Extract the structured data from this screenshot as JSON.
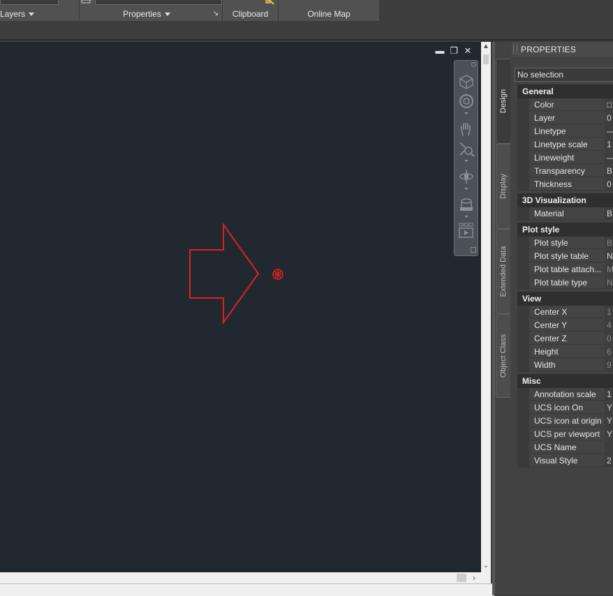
{
  "ribbon": {
    "panels": [
      {
        "label": "Layers",
        "dropdown": true
      },
      {
        "label": "Properties",
        "dropdown": true
      },
      {
        "label": "Clipboard",
        "dropdown": false
      },
      {
        "label": "Online Map",
        "dropdown": false
      }
    ],
    "launcher_glyph": "↘"
  },
  "viewport": {
    "background": "#212830",
    "drawing_color": "#e02020",
    "controls": {
      "minimize": "▬",
      "restore": "❐",
      "close": "✕"
    }
  },
  "navbar": {
    "icons": [
      "viewcube-icon",
      "steering-wheel-icon",
      "pan-icon",
      "zoom-icon",
      "orbit-icon",
      "showmotion-icon",
      "play-icon"
    ]
  },
  "scrollbars": {
    "up": "▲",
    "down": "⌄",
    "right": "›"
  },
  "palette": {
    "title": "PROPERTIES",
    "tabs": [
      "Design",
      "Display",
      "Extended Data",
      "Object Class"
    ],
    "selection": "No selection",
    "categories": [
      {
        "name": "General",
        "rows": [
          {
            "label": "Color",
            "value": "□"
          },
          {
            "label": "Layer",
            "value": "0"
          },
          {
            "label": "Linetype",
            "value": "—"
          },
          {
            "label": "Linetype scale",
            "value": "1"
          },
          {
            "label": "Lineweight",
            "value": "—"
          },
          {
            "label": "Transparency",
            "value": "B"
          },
          {
            "label": "Thickness",
            "value": "0"
          }
        ]
      },
      {
        "name": "3D Visualization",
        "rows": [
          {
            "label": "Material",
            "value": "B"
          }
        ]
      },
      {
        "name": "Plot style",
        "rows": [
          {
            "label": "Plot style",
            "value": "B",
            "dim": true
          },
          {
            "label": "Plot style table",
            "value": "N"
          },
          {
            "label": "Plot table attach...",
            "value": "M",
            "dim": true
          },
          {
            "label": "Plot table type",
            "value": "N",
            "dim": true
          }
        ]
      },
      {
        "name": "View",
        "rows": [
          {
            "label": "Center X",
            "value": "1",
            "dim": true
          },
          {
            "label": "Center Y",
            "value": "4",
            "dim": true
          },
          {
            "label": "Center Z",
            "value": "0",
            "dim": true
          },
          {
            "label": "Height",
            "value": "6",
            "dim": true
          },
          {
            "label": "Width",
            "value": "9",
            "dim": true
          }
        ]
      },
      {
        "name": "Misc",
        "rows": [
          {
            "label": "Annotation scale",
            "value": "1"
          },
          {
            "label": "UCS icon On",
            "value": "Y"
          },
          {
            "label": "UCS icon at origin",
            "value": "Y"
          },
          {
            "label": "UCS per viewport",
            "value": "Y"
          },
          {
            "label": "UCS Name",
            "value": ""
          },
          {
            "label": "Visual Style",
            "value": "2"
          }
        ]
      }
    ]
  }
}
